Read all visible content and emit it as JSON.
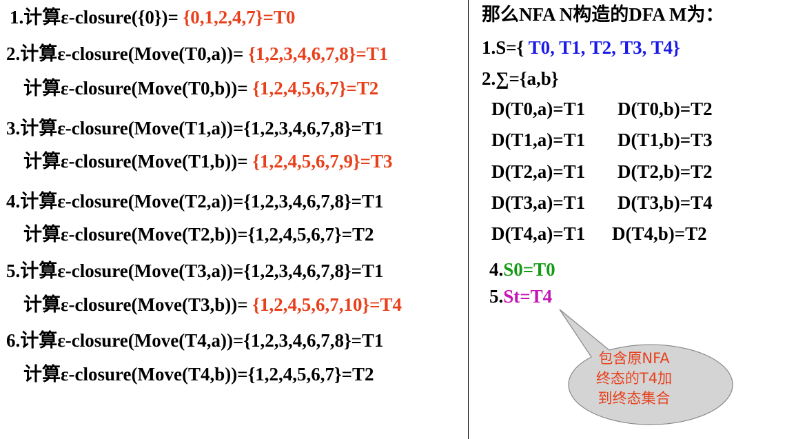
{
  "left": {
    "lines": [
      {
        "prefix": "1.计算ε-closure({0})= ",
        "highlight": "{0,1,2,4,7}=T0",
        "color": "red"
      },
      {
        "prefix": "2.计算ε-closure(Move(T0,a))= ",
        "highlight": "{1,2,3,4,6,7,8}=T1",
        "color": "red"
      },
      {
        "prefix": "计算ε-closure(Move(T0,b))= ",
        "highlight": "{1,2,4,5,6,7}=T2",
        "color": "red"
      },
      {
        "prefix": "3.计算ε-closure(Move(T1,a))={1,2,3,4,6,7,8}=T1",
        "highlight": "",
        "color": "black"
      },
      {
        "prefix": "计算ε-closure(Move(T1,b))= ",
        "highlight": "{1,2,4,5,6,7,9}=T3",
        "color": "red"
      },
      {
        "prefix": "4.计算ε-closure(Move(T2,a))={1,2,3,4,6,7,8}=T1",
        "highlight": "",
        "color": "black"
      },
      {
        "prefix": "计算ε-closure(Move(T2,b))={1,2,4,5,6,7}=T2",
        "highlight": "",
        "color": "black"
      },
      {
        "prefix": "5.计算ε-closure(Move(T3,a))={1,2,3,4,6,7,8}=T1",
        "highlight": "",
        "color": "black"
      },
      {
        "prefix": "计算ε-closure(Move(T3,b))= ",
        "highlight": "{1,2,4,5,6,7,10}=T4",
        "color": "red"
      },
      {
        "prefix": "6.计算ε-closure(Move(T4,a))={1,2,3,4,6,7,8}=T1",
        "highlight": "",
        "color": "black"
      },
      {
        "prefix": "计算ε-closure(Move(T4,b))={1,2,4,5,6,7}=T2",
        "highlight": "",
        "color": "black"
      }
    ]
  },
  "right": {
    "heading": "那么NFA N构造的DFA M为：",
    "states_prefix": "1.S={ ",
    "states_value": "T0, T1, T2, T3, T4}",
    "alphabet": "2.∑={a,b}",
    "transitions": [
      {
        "a": "D(T0,a)=T1",
        "b": "D(T0,b)=T2"
      },
      {
        "a": "D(T1,a)=T1",
        "b": "D(T1,b)=T3"
      },
      {
        "a": "D(T2,a)=T1",
        "b": "D(T2,b)=T2"
      },
      {
        "a": "D(T3,a)=T1",
        "b": "D(T3,b)=T4"
      },
      {
        "a": "D(T4,a)=T1",
        "b": "D(T4,b)=T2"
      }
    ],
    "start_prefix": "4.",
    "start_value": "S0=T0",
    "final_prefix": "5.",
    "final_value": "St=T4"
  },
  "callout": {
    "line1": "包含原NFA",
    "line2": "终态的T4加",
    "line3": "到终态集合"
  },
  "colors": {
    "red": "#e8401c",
    "blue": "#1a1ae6",
    "green": "#159a15",
    "magenta": "#c414b4",
    "callout_fill": "#d4d4d4"
  }
}
